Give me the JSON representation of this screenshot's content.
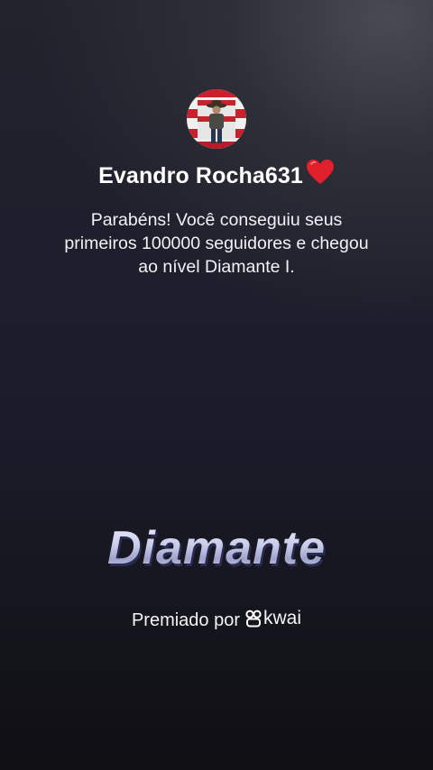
{
  "profile": {
    "username": "Evandro Rocha631",
    "heart_icon": "red-heart-emoji",
    "avatar_icon": "user-avatar"
  },
  "message": "Parabéns! Você conseguiu seus primeiros 100000 seguidores e chegou ao nível Diamante I.",
  "level": {
    "name": "Diamante"
  },
  "award": {
    "label": "Premiado por",
    "brand_name": "kwai",
    "brand_icon": "kwai-logo-icon"
  },
  "colors": {
    "accent_heart": "#e0202a",
    "level_text": "#cdd0ea"
  }
}
